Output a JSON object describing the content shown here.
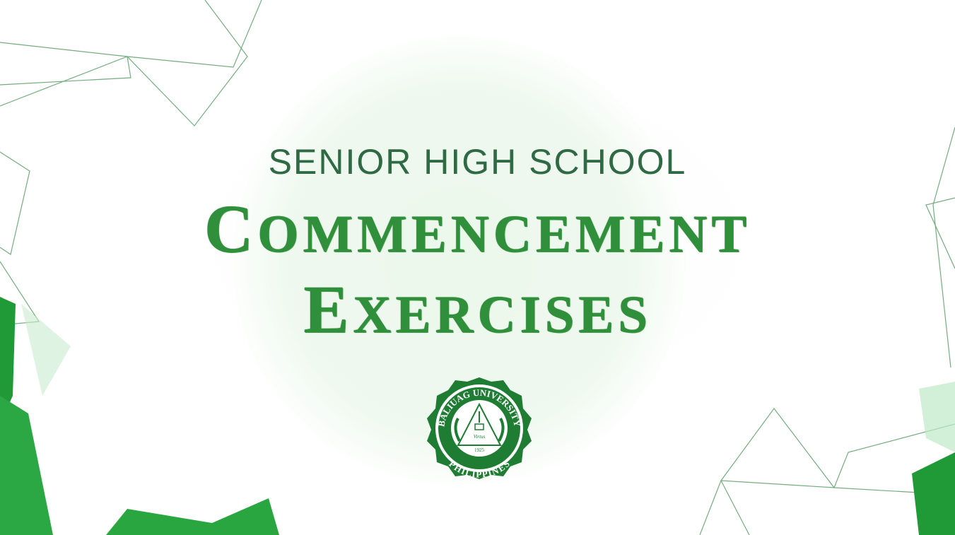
{
  "slide": {
    "subtitle": "SENIOR HIGH SCHOOL",
    "title_line1": {
      "first": "C",
      "rest": "OMMENCEMENT"
    },
    "title_line2": {
      "first": "E",
      "rest": "XERCISES"
    }
  },
  "seal": {
    "top_text": "BALIUAG UNIVERSITY",
    "bottom_text": "PHILIPPINES",
    "motto": "Virtus",
    "year": "1925"
  },
  "colors": {
    "primary_green": "#1e7d32",
    "text_green": "#2f6a45",
    "title_green": "#2f8f3a"
  }
}
